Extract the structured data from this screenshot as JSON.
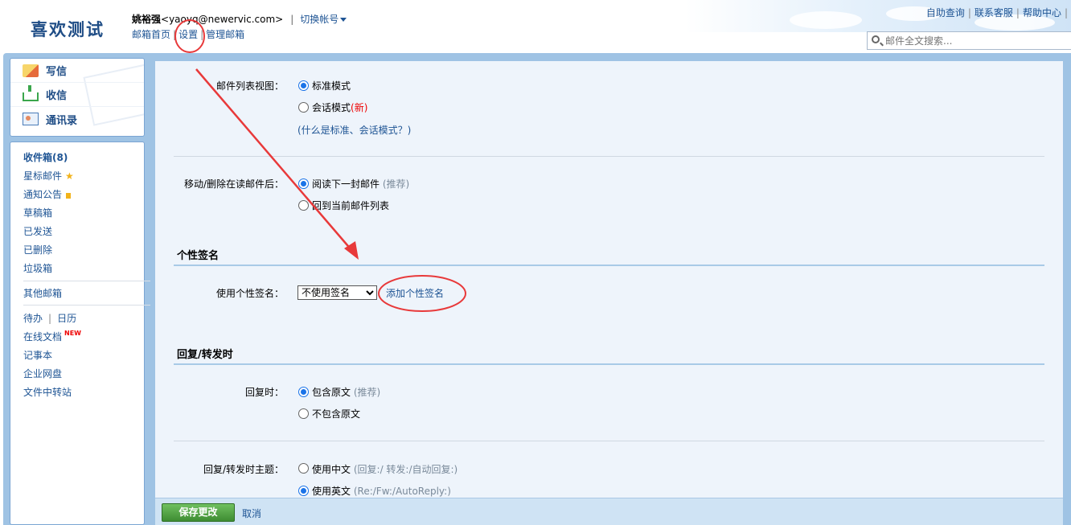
{
  "header": {
    "logo": "喜欢测试",
    "user_name": "姚裕强",
    "user_email": "<yaoyq@newervic.com>",
    "user_sep": "|",
    "switch_account": "切换帐号",
    "nav": {
      "home": "邮箱首页",
      "sep": "|",
      "settings": "设置",
      "manage": "管理邮箱"
    },
    "top_links": [
      "自助查询",
      "联系客服",
      "帮助中心"
    ],
    "top_sep": "|",
    "search_placeholder": "邮件全文搜索..."
  },
  "compose": {
    "write": "写信",
    "receive": "收信",
    "contacts": "通讯录"
  },
  "folders": {
    "inbox": "收件箱(8)",
    "starred": "星标邮件",
    "star_glyph": "★",
    "notices": "通知公告",
    "drafts": "草稿箱",
    "sent": "已发送",
    "deleted": "已删除",
    "spam": "垃圾箱",
    "other_mailboxes": "其他邮箱",
    "todo": "待办",
    "sep": "|",
    "calendar": "日历",
    "online_docs": "在线文档",
    "new_badge": "NEW",
    "notes": "记事本",
    "netdisk": "企业网盘",
    "transfer": "文件中转站"
  },
  "settings": {
    "list_view": {
      "label": "邮件列表视图：",
      "standard": "标准模式",
      "conversation": "会话模式",
      "new_mark": "(新)",
      "help_link": "(什么是标准、会话模式？)"
    },
    "after_move": {
      "label": "移动/删除在读邮件后：",
      "next_mail": "阅读下一封邮件",
      "recommend": "(推荐)",
      "back_to_list": "回到当前邮件列表"
    },
    "signature_section": "个性签名",
    "signature": {
      "label": "使用个性签名：",
      "selected": "不使用签名",
      "add_link": "添加个性签名"
    },
    "reply_section": "回复/转发时",
    "reply": {
      "label": "回复时：",
      "include_original": "包含原文",
      "recommend": "(推荐)",
      "exclude_original": "不包含原文"
    },
    "subject": {
      "label": "回复/转发时主题：",
      "chinese": "使用中文",
      "chinese_hint": "(回复:/ 转发:/自动回复:)",
      "english": "使用英文",
      "english_hint": "(Re:/Fw:/AutoReply:)"
    }
  },
  "bottom": {
    "save": "保存更改",
    "cancel": "取消"
  },
  "colors": {
    "annotation": "#e8393a",
    "frame": "#9fc3e4",
    "link": "#1e5494",
    "save_button": "#4a9b3c"
  }
}
